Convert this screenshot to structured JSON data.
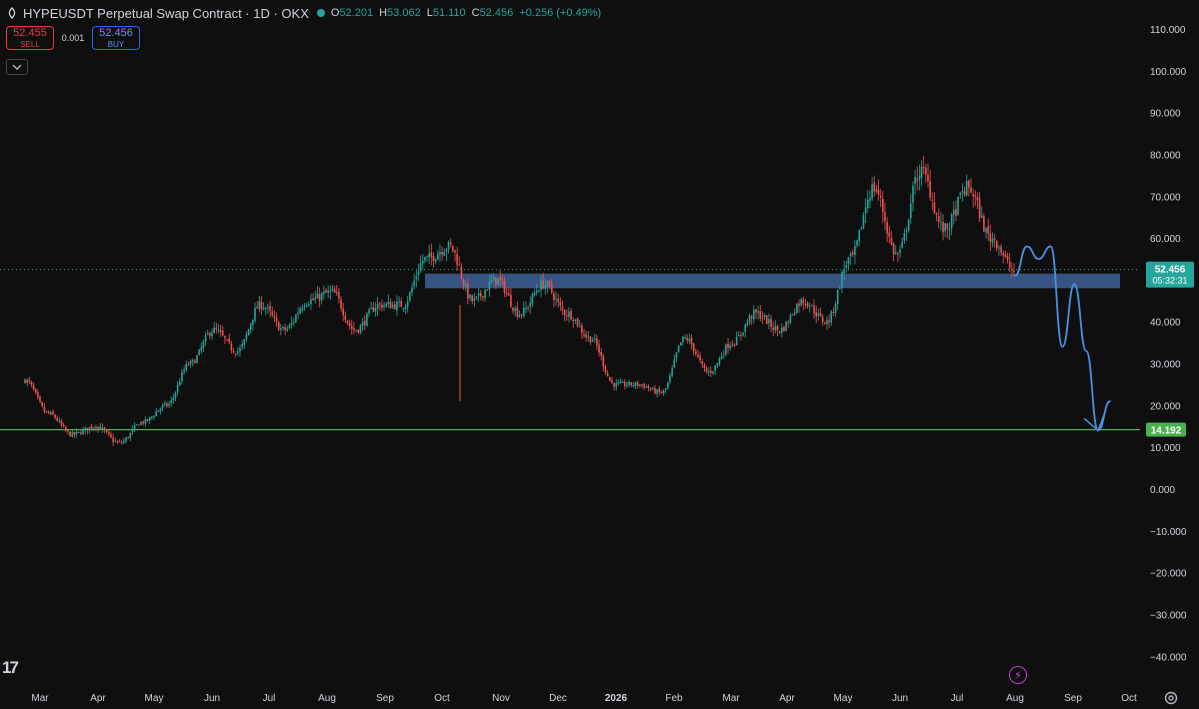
{
  "header": {
    "title": "HYPEUSDT Perpetual Swap Contract · 1D · OKX",
    "ohlc": [
      {
        "k": "O",
        "v": "52.201"
      },
      {
        "k": "H",
        "v": "53.062"
      },
      {
        "k": "L",
        "v": "51.110"
      },
      {
        "k": "C",
        "v": "52.456"
      },
      {
        "k": "",
        "v": "+0.256 (+0.49%)"
      }
    ]
  },
  "trade": {
    "sell_price": "52.455",
    "sell_label": "SELL",
    "spread": "0.001",
    "buy_price": "52.456",
    "buy_label": "BUY"
  },
  "price_badge": {
    "value": "52.456",
    "countdown": "05:32:31",
    "color": "#26a69a"
  },
  "level_badge": {
    "value": "14.192",
    "color": "#4caf50"
  },
  "logo_text": "17",
  "colors": {
    "up": "#26a69a",
    "down": "#ef5350",
    "zone": "#3e5f96",
    "drawing": "#4a90e2",
    "level": "#4caf50"
  },
  "chart_data": {
    "type": "candlestick",
    "y_ticks": [
      "110.000",
      "100.000",
      "90.000",
      "80.000",
      "70.000",
      "60.000",
      "50.000",
      "40.000",
      "30.000",
      "20.000",
      "10.000",
      "0.000",
      "−10.000",
      "−20.000",
      "−30.000",
      "−40.000"
    ],
    "ylim": [
      -40,
      110
    ],
    "x_ticks": [
      "Mar",
      "Apr",
      "May",
      "Jun",
      "Jul",
      "Aug",
      "Sep",
      "Oct",
      "Nov",
      "Dec",
      "2026",
      "Feb",
      "Mar",
      "Apr",
      "May",
      "Jun",
      "Jul",
      "Aug",
      "Sep",
      "Oct"
    ],
    "grid": false,
    "last_price": 52.456,
    "horizontal_level": 14.192,
    "zone": {
      "from": 48,
      "to": 51.5
    },
    "price_anchors": [
      [
        "Mar",
        26
      ],
      [
        "Mar",
        18
      ],
      [
        "Mar",
        13
      ],
      [
        "Apr",
        15
      ],
      [
        "Apr",
        11
      ],
      [
        "Apr",
        16
      ],
      [
        "May",
        20
      ],
      [
        "May",
        30
      ],
      [
        "May",
        38
      ],
      [
        "Jun",
        33
      ],
      [
        "Jun",
        44
      ],
      [
        "Jul",
        38
      ],
      [
        "Jul",
        45
      ],
      [
        "Aug",
        47
      ],
      [
        "Aug",
        38
      ],
      [
        "Aug",
        44
      ],
      [
        "Sep",
        44
      ],
      [
        "Sep",
        55
      ],
      [
        "Sep",
        58
      ],
      [
        "Oct",
        45
      ],
      [
        "Oct",
        50
      ],
      [
        "Oct",
        42
      ],
      [
        "Nov",
        49
      ],
      [
        "Nov",
        42
      ],
      [
        "Dec",
        36
      ],
      [
        "Dec",
        25
      ],
      [
        "2026",
        25
      ],
      [
        "Feb",
        23
      ],
      [
        "Feb",
        36
      ],
      [
        "Feb",
        28
      ],
      [
        "Mar",
        35
      ],
      [
        "Mar",
        42
      ],
      [
        "Apr",
        38
      ],
      [
        "Apr",
        45
      ],
      [
        "May",
        40
      ],
      [
        "May",
        55
      ],
      [
        "Jun",
        72
      ],
      [
        "Jun",
        56
      ],
      [
        "Jun",
        76
      ],
      [
        "Jul",
        62
      ],
      [
        "Jul",
        72
      ],
      [
        "Jul",
        60
      ],
      [
        "Aug",
        52
      ]
    ],
    "projection": [
      [
        "Aug",
        51
      ],
      [
        "Aug",
        58
      ],
      [
        "Aug",
        55
      ],
      [
        "Aug",
        58
      ],
      [
        "Sep",
        34
      ],
      [
        "Sep",
        49
      ],
      [
        "Sep",
        33
      ],
      [
        "Sep",
        14
      ],
      [
        "Oct",
        21
      ]
    ]
  }
}
